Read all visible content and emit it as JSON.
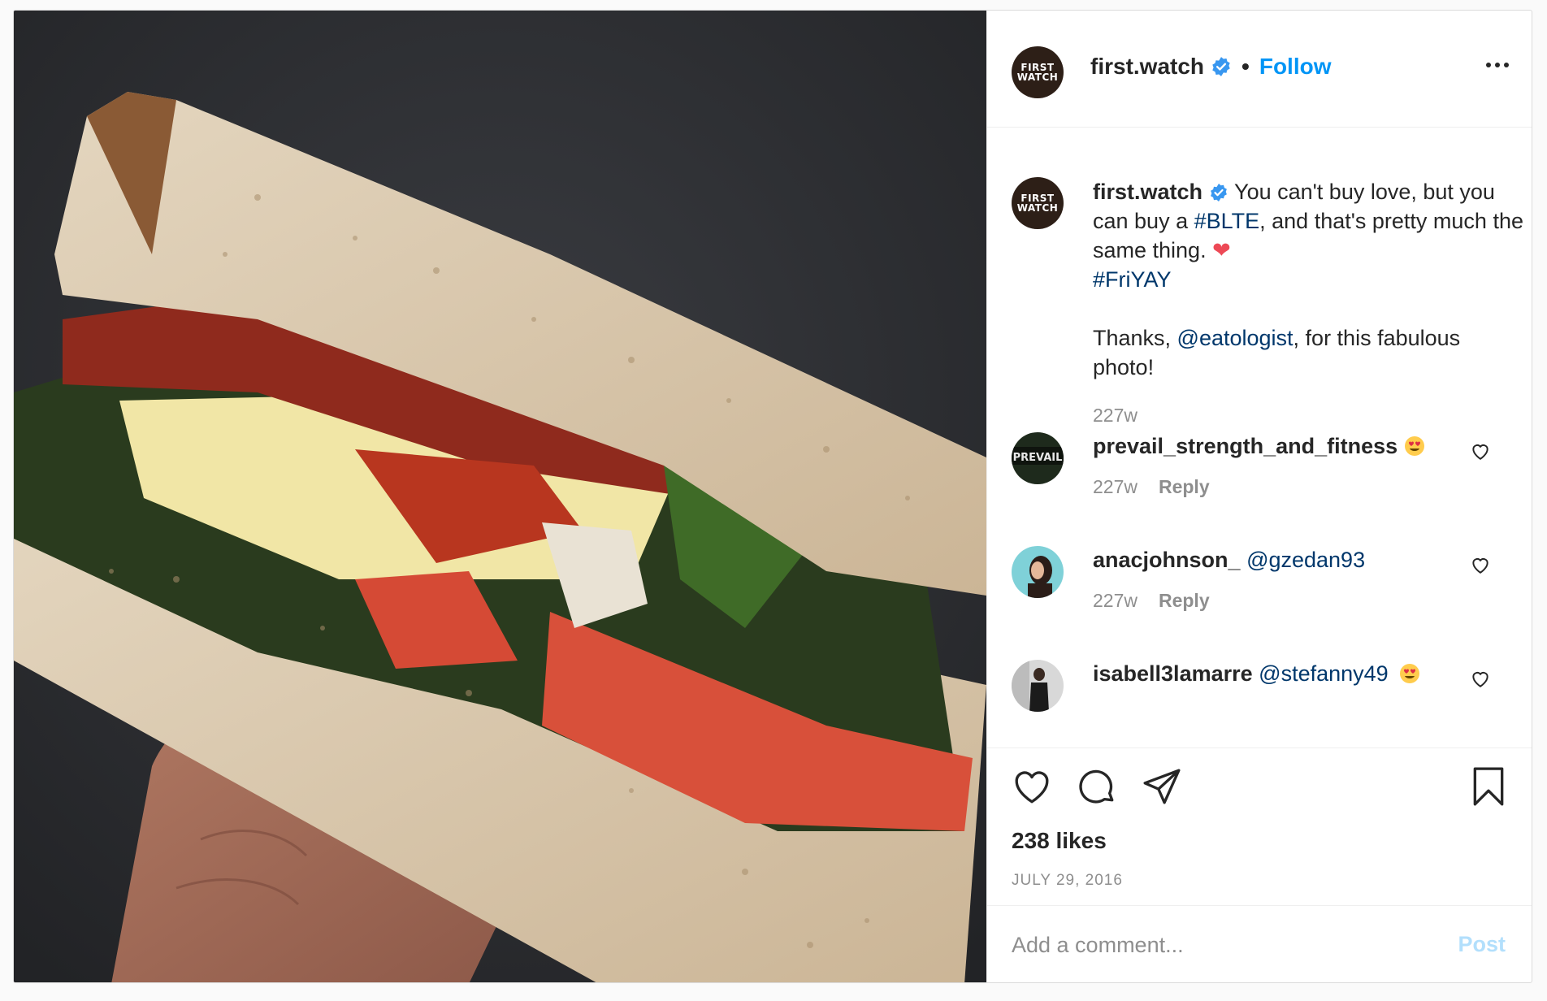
{
  "post": {
    "photo_alt": "BLTE sandwich held in hand",
    "author": {
      "username": "first.watch",
      "avatar_text_line1": "FIRST",
      "avatar_text_line2": "WATCH",
      "verified": true
    },
    "follow_label": "Follow",
    "separator": "•",
    "caption": {
      "username": "first.watch",
      "text_part1": " You can't buy love, but you can buy a ",
      "hashtag1": "#BLTE",
      "text_part2": ", and that's pretty much the same thing. ",
      "heart": "❤",
      "hashtag2": "#FriYAY",
      "thanks_pre": "Thanks, ",
      "mention": "@eatologist",
      "thanks_post": ", for this fabulous photo!",
      "time": "227w"
    },
    "comments": [
      {
        "username": "prevail_strength_and_fitness",
        "text": "",
        "mention": "",
        "emoji": "heart-eyes",
        "time": "227w",
        "reply_label": "Reply"
      },
      {
        "username": "anacjohnson_",
        "text": " ",
        "mention": "@gzedan93",
        "emoji": "",
        "time": "227w",
        "reply_label": "Reply"
      },
      {
        "username": "isabell3lamarre",
        "text": " ",
        "mention": "@stefanny49",
        "emoji": "heart-eyes",
        "time": "",
        "reply_label": ""
      }
    ],
    "likes": "238 likes",
    "date": "JULY 29, 2016",
    "comment_input": {
      "placeholder": "Add a comment...",
      "value": ""
    },
    "post_button": "Post",
    "icons": {
      "like": "heart-outline-icon",
      "comment": "comment-bubble-icon",
      "share": "paper-plane-icon",
      "save": "bookmark-icon",
      "more": "more-horizontal-icon",
      "verified": "verified-badge-icon"
    },
    "colors": {
      "link": "#0095f6",
      "hashtag": "#00376b",
      "muted": "#8e8e8e",
      "post_disabled": "#b2dffc",
      "brand_avatar": "#2d1f17"
    }
  }
}
